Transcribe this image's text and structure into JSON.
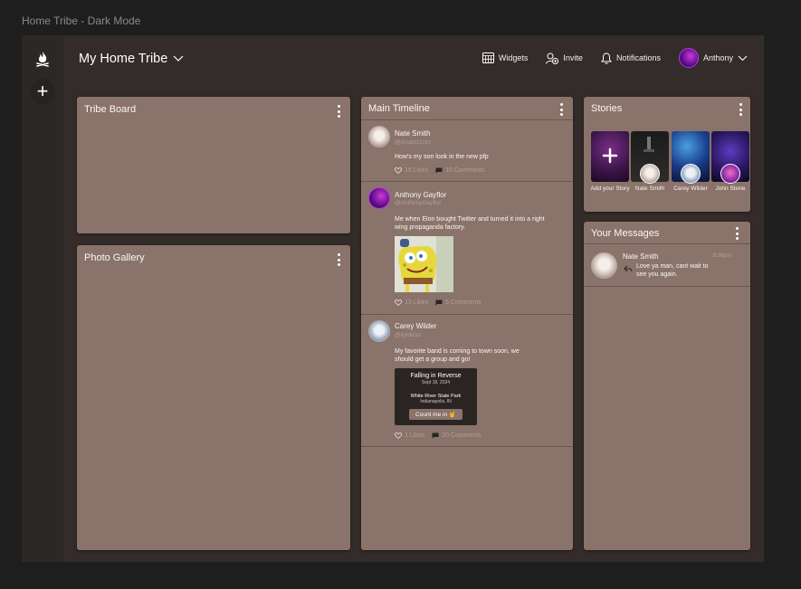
{
  "frame_title": "Home Tribe - Dark Mode",
  "topbar": {
    "title": "My Home Tribe",
    "widgets": "Widgets",
    "invite": "Invite",
    "notifications": "Notifications",
    "user": "Anthony"
  },
  "tribe_board": {
    "title": "Tribe Board"
  },
  "photo_gallery": {
    "title": "Photo Gallery"
  },
  "timeline": {
    "title": "Main Timeline",
    "posts": [
      {
        "name": "Nate Smith",
        "handle": "@Gnatzzzzzz",
        "text": "How's my son look in the new pfp",
        "likes": "15 Likes",
        "comments": "10 Comments"
      },
      {
        "name": "Anthony Gayflor",
        "handle": "@AnthonyGayflor",
        "text": "Me when Elon bought Twitter and turned it into a right wing propaganda factory.",
        "likes": "13 Likes",
        "comments": "5 Comments"
      },
      {
        "name": "Carey Wilder",
        "handle": "@kyldizzz",
        "text": "My favorite band is coming to town soon, we should get a group and go!",
        "likes": "1 Likes",
        "comments": "20 Comments",
        "event": {
          "title": "Falling in Reverse",
          "date": "Sept 18, 2024",
          "venue": "White River State Park",
          "city": "Indianapolis, IN",
          "button": "Count me in 🤘"
        }
      }
    ]
  },
  "stories": {
    "title": "Stories",
    "items": [
      {
        "label": "Add your Story"
      },
      {
        "label": "Nate Smith"
      },
      {
        "label": "Carey Wilder"
      },
      {
        "label": "John Stone"
      }
    ]
  },
  "messages": {
    "title": "Your Messages",
    "items": [
      {
        "name": "Nate Smith",
        "time": "9:36pm",
        "text": "Love ya man, cant wait to see you again."
      }
    ]
  },
  "colors": {
    "card": "#8a736a",
    "app_bg": "#332c2a",
    "rail": "#2b2826",
    "page_bg": "#1e1e1e"
  }
}
